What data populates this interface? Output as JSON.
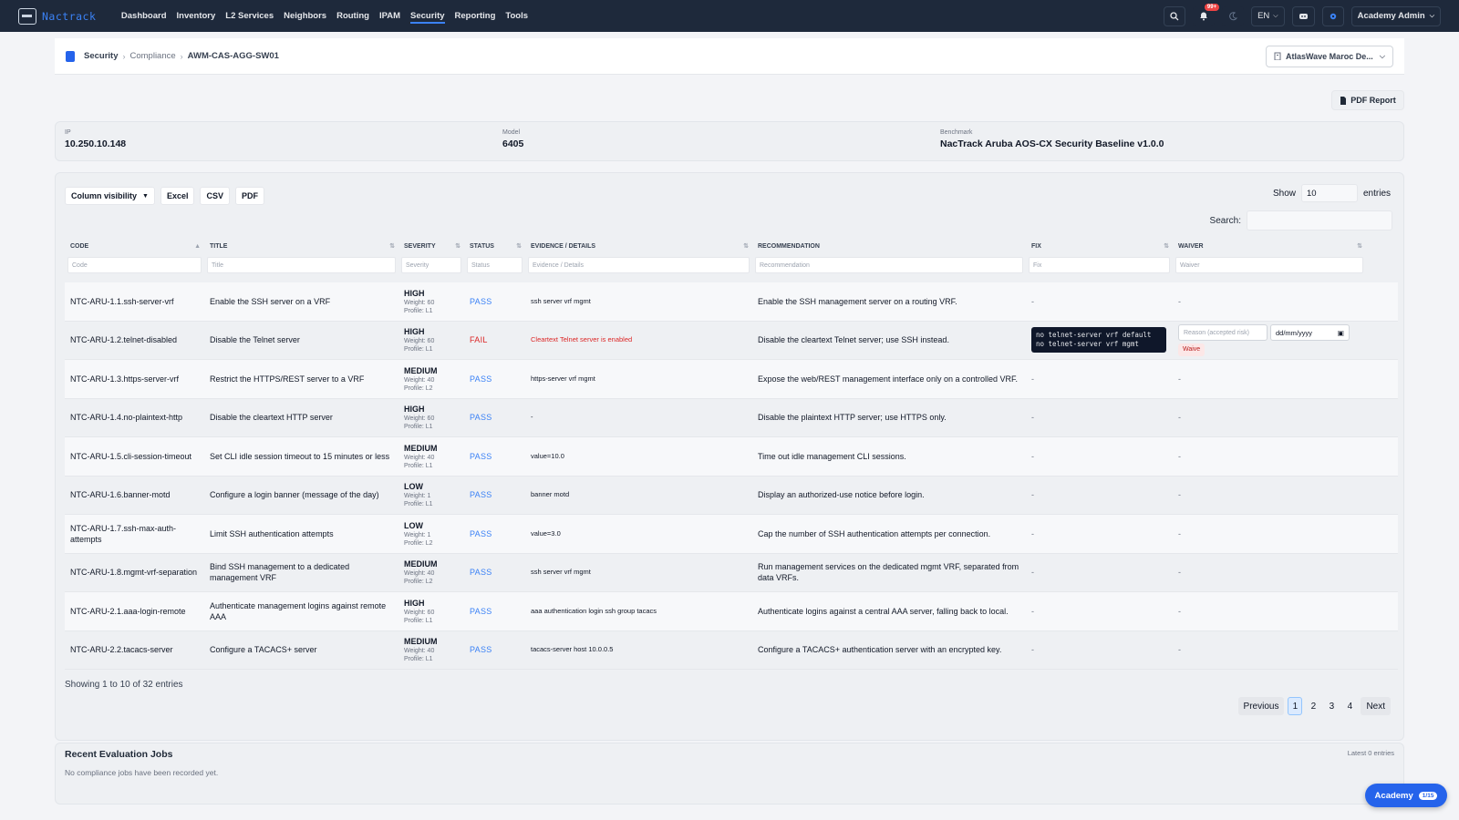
{
  "app": {
    "brand_name": "Nactrack",
    "accent_color": "#3b82f6"
  },
  "topnav": {
    "items": [
      {
        "label": "Dashboard"
      },
      {
        "label": "Inventory"
      },
      {
        "label": "L2 Services"
      },
      {
        "label": "Neighbors"
      },
      {
        "label": "Routing"
      },
      {
        "label": "IPAM"
      },
      {
        "label": "Security",
        "active": true
      },
      {
        "label": "Reporting"
      },
      {
        "label": "Tools"
      }
    ],
    "notifications_count": "99+",
    "language": "EN",
    "user": "Academy Admin"
  },
  "breadcrumb": {
    "items": [
      "Security",
      "Compliance",
      "AWM-CAS-AGG-SW01"
    ],
    "organization": "AtlasWave Maroc De..."
  },
  "actions": {
    "pdf_report": "PDF Report"
  },
  "device": {
    "ip_label": "IP",
    "ip": "10.250.10.148",
    "model_label": "Model",
    "model": "6405",
    "benchmark_label": "Benchmark",
    "benchmark": "NacTrack Aruba AOS-CX Security Baseline v1.0.0"
  },
  "table": {
    "toolbar": {
      "column_visibility": "Column visibility",
      "excel": "Excel",
      "csv": "CSV",
      "pdf": "PDF"
    },
    "show_label": "Show",
    "show_value": "10",
    "entries_label": "entries",
    "search_label": "Search:",
    "columns": [
      {
        "label": "Code",
        "filter": "Code"
      },
      {
        "label": "Title",
        "filter": "Title"
      },
      {
        "label": "Severity",
        "filter": "Severity"
      },
      {
        "label": "Status",
        "filter": "Status"
      },
      {
        "label": "Evidence / Details",
        "filter": "Evidence / Details"
      },
      {
        "label": "Recommendation",
        "filter": "Recommendation"
      },
      {
        "label": "Fix",
        "filter": "Fix"
      },
      {
        "label": "Waiver",
        "filter": "Waiver"
      }
    ],
    "rows": [
      {
        "code": "NTC-ARU-1.1.ssh-server-vrf",
        "title": "Enable the SSH server on a VRF",
        "severity": "HIGH",
        "weight": "Weight: 60",
        "profile": "Profile: L1",
        "status": "PASS",
        "evidence": "ssh server vrf mgmt",
        "recommendation": "Enable the SSH management server on a routing VRF.",
        "fix": "-",
        "waiver": "-"
      },
      {
        "code": "NTC-ARU-1.2.telnet-disabled",
        "title": "Disable the Telnet server",
        "severity": "HIGH",
        "weight": "Weight: 60",
        "profile": "Profile: L1",
        "status": "FAIL",
        "evidence": "Cleartext Telnet server is enabled",
        "recommendation": "Disable the cleartext Telnet server; use SSH instead.",
        "fix_lines": [
          "no telnet-server vrf default",
          "no telnet-server vrf mgmt"
        ],
        "waiver_reason_placeholder": "Reason (accepted risk)",
        "waiver_date_placeholder": "dd/mm/yyyy",
        "waive_label": "Waive"
      },
      {
        "code": "NTC-ARU-1.3.https-server-vrf",
        "title": "Restrict the HTTPS/REST server to a VRF",
        "severity": "MEDIUM",
        "weight": "Weight: 40",
        "profile": "Profile: L2",
        "status": "PASS",
        "evidence": "https-server vrf mgmt",
        "recommendation": "Expose the web/REST management interface only on a controlled VRF.",
        "fix": "-",
        "waiver": "-"
      },
      {
        "code": "NTC-ARU-1.4.no-plaintext-http",
        "title": "Disable the cleartext HTTP server",
        "severity": "HIGH",
        "weight": "Weight: 60",
        "profile": "Profile: L1",
        "status": "PASS",
        "evidence": "-",
        "recommendation": "Disable the plaintext HTTP server; use HTTPS only.",
        "fix": "-",
        "waiver": "-"
      },
      {
        "code": "NTC-ARU-1.5.cli-session-timeout",
        "title": "Set CLI idle session timeout to 15 minutes or less",
        "severity": "MEDIUM",
        "weight": "Weight: 40",
        "profile": "Profile: L1",
        "status": "PASS",
        "evidence": "value=10.0",
        "recommendation": "Time out idle management CLI sessions.",
        "fix": "-",
        "waiver": "-"
      },
      {
        "code": "NTC-ARU-1.6.banner-motd",
        "title": "Configure a login banner (message of the day)",
        "severity": "LOW",
        "weight": "Weight: 1",
        "profile": "Profile: L1",
        "status": "PASS",
        "evidence": "banner motd",
        "recommendation": "Display an authorized-use notice before login.",
        "fix": "-",
        "waiver": "-"
      },
      {
        "code": "NTC-ARU-1.7.ssh-max-auth-attempts",
        "title": "Limit SSH authentication attempts",
        "severity": "LOW",
        "weight": "Weight: 1",
        "profile": "Profile: L2",
        "status": "PASS",
        "evidence": "value=3.0",
        "recommendation": "Cap the number of SSH authentication attempts per connection.",
        "fix": "-",
        "waiver": "-"
      },
      {
        "code": "NTC-ARU-1.8.mgmt-vrf-separation",
        "title": "Bind SSH management to a dedicated management VRF",
        "severity": "MEDIUM",
        "weight": "Weight: 40",
        "profile": "Profile: L2",
        "status": "PASS",
        "evidence": "ssh server vrf mgmt",
        "recommendation": "Run management services on the dedicated mgmt VRF, separated from data VRFs.",
        "fix": "-",
        "waiver": "-"
      },
      {
        "code": "NTC-ARU-2.1.aaa-login-remote",
        "title": "Authenticate management logins against remote AAA",
        "severity": "HIGH",
        "weight": "Weight: 60",
        "profile": "Profile: L1",
        "status": "PASS",
        "evidence": "aaa authentication login ssh group tacacs",
        "recommendation": "Authenticate logins against a central AAA server, falling back to local.",
        "fix": "-",
        "waiver": "-"
      },
      {
        "code": "NTC-ARU-2.2.tacacs-server",
        "title": "Configure a TACACS+ server",
        "severity": "MEDIUM",
        "weight": "Weight: 40",
        "profile": "Profile: L1",
        "status": "PASS",
        "evidence": "tacacs-server host 10.0.0.5",
        "recommendation": "Configure a TACACS+ authentication server with an encrypted key.",
        "fix": "-",
        "waiver": "-"
      }
    ],
    "showing_text": "Showing 1 to 10 of 32 entries",
    "pagination": {
      "previous": "Previous",
      "pages": [
        "1",
        "2",
        "3",
        "4"
      ],
      "current": "1",
      "next": "Next"
    }
  },
  "jobs": {
    "title": "Recent Evaluation Jobs",
    "count": "Latest 0 entries",
    "empty": "No compliance jobs have been recorded yet."
  },
  "academy": {
    "label": "Academy",
    "progress": "1/15"
  }
}
